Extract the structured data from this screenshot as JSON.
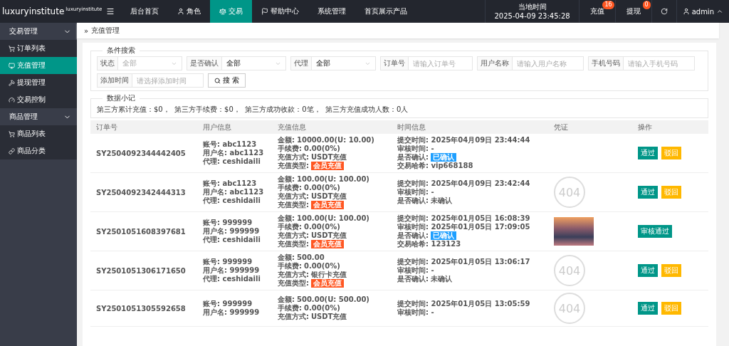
{
  "logo": {
    "name": "luxuryinstitute",
    "sup": "luxuryinstitute"
  },
  "topnav": [
    {
      "label": "后台首页",
      "selected": false
    },
    {
      "label": "角色",
      "selected": false
    },
    {
      "label": "交易",
      "selected": true
    },
    {
      "label": "帮助中心",
      "selected": false
    },
    {
      "label": "系统管理",
      "selected": false
    },
    {
      "label": "首页展示产品",
      "selected": false
    }
  ],
  "clock": {
    "label": "当地时间",
    "time": "2025-04-09 23:45:28"
  },
  "notices": [
    {
      "label": "充值",
      "count": "16"
    },
    {
      "label": "提现",
      "count": "0"
    }
  ],
  "user": {
    "name": "admin"
  },
  "sidebar": [
    {
      "label": "交易管理",
      "expanded": true,
      "children": [
        {
          "label": "订单列表",
          "selected": false
        },
        {
          "label": "充值管理",
          "selected": true
        },
        {
          "label": "提现管理",
          "selected": false
        },
        {
          "label": "交易控制",
          "selected": false
        }
      ]
    },
    {
      "label": "商品管理",
      "expanded": true,
      "children": [
        {
          "label": "商品列表",
          "selected": false
        },
        {
          "label": "商品分类",
          "selected": false
        }
      ]
    }
  ],
  "breadcrumb": {
    "separator": "»",
    "label": "充值管理"
  },
  "search": {
    "legend": "条件搜索",
    "fields": [
      {
        "kind": "select",
        "label": "状态",
        "placeholder": "全部"
      },
      {
        "kind": "select",
        "label": "是否确认",
        "value": "全部"
      },
      {
        "kind": "select",
        "label": "代理",
        "value": "全部"
      },
      {
        "kind": "input",
        "label": "订单号",
        "placeholder": "请输入订单号"
      },
      {
        "kind": "input",
        "label": "用户名称",
        "placeholder": "请输入用户名称"
      },
      {
        "kind": "input",
        "label": "手机号码",
        "placeholder": "请输入手机号码"
      },
      {
        "kind": "input",
        "label": "添加时间",
        "placeholder": "请选择添加时间"
      }
    ],
    "button": "搜 索"
  },
  "summary": {
    "legend": "数据小记",
    "text": "第三方累计充值：$0，  第三方手续费：$0，  第三方成功收款：0笔，  第三方充值成功人数：0人"
  },
  "table": {
    "columns": [
      "订单号",
      "用户信息",
      "充值信息",
      "时间信息",
      "凭证",
      "操作"
    ],
    "rows": [
      {
        "order": "SY2504092344442405",
        "user": [
          "账号: abc1123",
          "用户名: abc1123",
          "代理: ceshidaili"
        ],
        "recharge": [
          {
            "label": "金额:",
            "value": "10000.00(U: 10.00)",
            "kind": "text"
          },
          {
            "label": "手续费:",
            "value": "0.00(0%)",
            "kind": "text"
          },
          {
            "label": "充值方式:",
            "value": "USDT充值",
            "kind": "text"
          },
          {
            "label": "充值类型:",
            "value": "会员充值",
            "kind": "badge"
          }
        ],
        "time": [
          {
            "text": "提交时间: 2025年04月09日 23:44:44",
            "kind": "text"
          },
          {
            "text": "审核时间: -",
            "kind": "text"
          },
          {
            "label": "是否确认:",
            "value": "已确认",
            "kind": "badge"
          },
          {
            "text": "交易哈希: vip668188",
            "kind": "text"
          }
        ],
        "voucher": {
          "kind": "blank"
        },
        "actions": [
          {
            "kind": "pass",
            "label": "通过"
          },
          {
            "kind": "reject",
            "label": "驳回"
          }
        ]
      },
      {
        "order": "SY2504092342444313",
        "user": [
          "账号: abc1123",
          "用户名: abc1123",
          "代理: ceshidaili"
        ],
        "recharge": [
          {
            "label": "金额:",
            "value": "100.00(U: 100.00)",
            "kind": "text"
          },
          {
            "label": "手续费:",
            "value": "0.00(0%)",
            "kind": "text"
          },
          {
            "label": "充值方式:",
            "value": "USDT充值",
            "kind": "text"
          },
          {
            "label": "充值类型:",
            "value": "会员充值",
            "kind": "badge"
          }
        ],
        "time": [
          {
            "text": "提交时间: 2025年04月09日 23:42:44",
            "kind": "text"
          },
          {
            "text": "审核时间: -",
            "kind": "text"
          },
          {
            "text": "是否确认: 未确认",
            "kind": "text"
          }
        ],
        "voucher": {
          "kind": "missing",
          "text": "404"
        },
        "actions": [
          {
            "kind": "pass",
            "label": "通过"
          },
          {
            "kind": "reject",
            "label": "驳回"
          }
        ]
      },
      {
        "order": "SY2501051608397681",
        "user": [
          "账号: 999999",
          "用户名: 999999",
          "代理: ceshidaili"
        ],
        "recharge": [
          {
            "label": "金额:",
            "value": "100.00(U: 100.00)",
            "kind": "text"
          },
          {
            "label": "手续费:",
            "value": "0.00(0%)",
            "kind": "text"
          },
          {
            "label": "充值方式:",
            "value": "USDT充值",
            "kind": "text"
          },
          {
            "label": "充值类型:",
            "value": "会员充值",
            "kind": "badge"
          }
        ],
        "time": [
          {
            "text": "提交时间: 2025年01月05日 16:08:39",
            "kind": "text"
          },
          {
            "text": "审核时间: 2025年01月05日 17:09:05",
            "kind": "text"
          },
          {
            "label": "是否确认:",
            "value": "已确认",
            "kind": "badge"
          },
          {
            "text": "交易哈希: 123123",
            "kind": "text"
          }
        ],
        "voucher": {
          "kind": "photo"
        },
        "actions": [
          {
            "kind": "pass",
            "label": "审核通过"
          }
        ]
      },
      {
        "order": "SY2501051306171650",
        "user": [
          "账号: 999999",
          "用户名: 999999",
          "代理: ceshidaili"
        ],
        "recharge": [
          {
            "label": "金额:",
            "value": "500.00",
            "kind": "text"
          },
          {
            "label": "手续费:",
            "value": "0.00(0%)",
            "kind": "text"
          },
          {
            "label": "充值方式:",
            "value": "银行卡充值",
            "kind": "text"
          },
          {
            "label": "充值类型:",
            "value": "会员充值",
            "kind": "badge"
          }
        ],
        "time": [
          {
            "text": "提交时间: 2025年01月05日 13:06:17",
            "kind": "text"
          },
          {
            "text": "审核时间: -",
            "kind": "text"
          },
          {
            "text": "是否确认: 未确认",
            "kind": "text"
          }
        ],
        "voucher": {
          "kind": "missing",
          "text": "404"
        },
        "actions": [
          {
            "kind": "pass",
            "label": "通过"
          },
          {
            "kind": "reject",
            "label": "驳回"
          }
        ]
      },
      {
        "order": "SY2501051305592658",
        "user": [
          "账号: 999999",
          "用户名: 999999"
        ],
        "recharge": [
          {
            "label": "金额:",
            "value": "500.00(U: 500.00)",
            "kind": "text"
          },
          {
            "label": "手续费:",
            "value": "0.00(0%)",
            "kind": "text"
          },
          {
            "label": "充值方式:",
            "value": "USDT充值",
            "kind": "text"
          }
        ],
        "time": [
          {
            "text": "提交时间: 2025年01月05日 13:05:59",
            "kind": "text"
          },
          {
            "text": "审核时间: -",
            "kind": "text"
          }
        ],
        "voucher": {
          "kind": "missing",
          "text": "404"
        },
        "actions": [
          {
            "kind": "pass",
            "label": "通过"
          },
          {
            "kind": "reject",
            "label": "驳回"
          }
        ]
      }
    ]
  }
}
